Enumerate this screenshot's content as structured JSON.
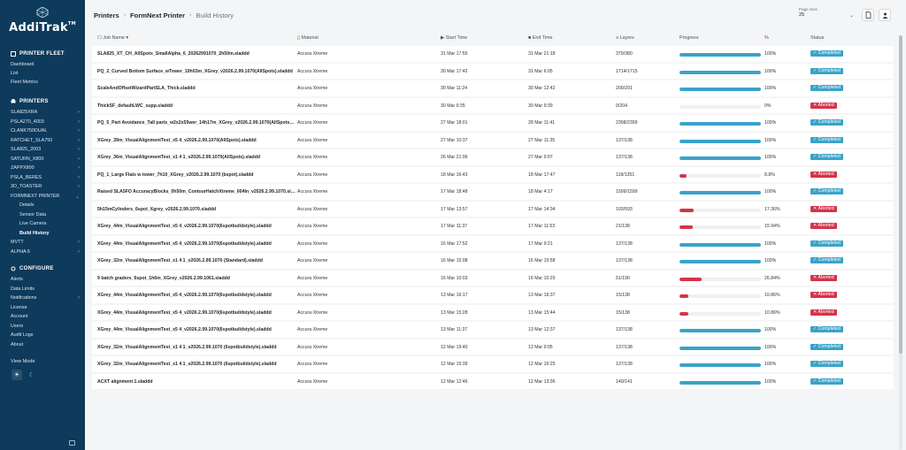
{
  "app": {
    "name": "AddiTrak",
    "trademark": "TM"
  },
  "sidebar": {
    "fleet_title": "PRINTER FLEET",
    "fleet_items": [
      "Dashboard",
      "List",
      "Fleet Metrics"
    ],
    "printers_title": "PRINTERS",
    "printers": [
      {
        "label": "SLA825XRA",
        "expand": true
      },
      {
        "label": "PSLA270_4003",
        "expand": true
      },
      {
        "label": "CLANK750DUAL",
        "expand": true
      },
      {
        "label": "RATCHET_SLA750",
        "expand": true
      },
      {
        "label": "SLA825_2003",
        "expand": true
      },
      {
        "label": "SATURN_X800",
        "expand": true
      },
      {
        "label": "ZAPPX800",
        "expand": true
      },
      {
        "label": "PSLA_BERES",
        "expand": true
      },
      {
        "label": "3D_TOASTER",
        "expand": true
      },
      {
        "label": "FORMNEXT PRINTER",
        "expand": true
      }
    ],
    "printer_sub": [
      "Details",
      "Sensor Data",
      "Live Camera",
      "Build History"
    ],
    "printers_after": [
      {
        "label": "MVTT",
        "expand": true
      },
      {
        "label": "ALPHA 6",
        "expand": true
      }
    ],
    "configure_title": "CONFIGURE",
    "configure_items": [
      {
        "label": "Alerts",
        "expand": false
      },
      {
        "label": "Data Limits",
        "expand": false
      },
      {
        "label": "Notifications",
        "expand": true
      },
      {
        "label": "License",
        "expand": false
      },
      {
        "label": "Account",
        "expand": false
      },
      {
        "label": "Users",
        "expand": false
      },
      {
        "label": "Audit Logs",
        "expand": false
      },
      {
        "label": "About",
        "expand": false
      }
    ],
    "view_mode_label": "View Mode"
  },
  "header": {
    "crumb1": "Printers",
    "crumb2": "FormNext Printer",
    "crumb3": "Build History",
    "page_size_label": "Page Size",
    "page_size_value": "25"
  },
  "table": {
    "columns": {
      "name": "Job Name",
      "material": "Material",
      "start": "Start Time",
      "end": "End Time",
      "layers": "Layers",
      "progress": "Progress",
      "pct": "%",
      "status": "Status"
    },
    "colors": {
      "completed": "#3aa3c9",
      "aborted": "#d6334a"
    },
    "rows": [
      {
        "name": "SLA825_XT_CH_AllSpots_SmallAlpha_6_20262991070_2h50m.sladdd",
        "material": "Accura Xtreme",
        "start": "31 Mar 17:55",
        "end": "31 Mar 21:18",
        "layers": "379/380",
        "pct": "100%",
        "progress": 1.0,
        "status": "Completed"
      },
      {
        "name": "PQ_2_Curved Bottom Surface_wTower_10h03m_XGrey_v2026.2.99.1070(AllSpots).sladdd",
        "material": "Accura Xtreme",
        "start": "30 Mar 17:42",
        "end": "31 Mar 6:05",
        "layers": "1714/1715",
        "pct": "100%",
        "progress": 1.0,
        "status": "Completed"
      },
      {
        "name": "ScaleAndOffsetWizardPartSLA_Thick.sladdd",
        "material": "Accura Xtreme",
        "start": "30 Mar 11:24",
        "end": "30 Mar 12:42",
        "layers": "200/201",
        "pct": "100%",
        "progress": 1.0,
        "status": "Completed"
      },
      {
        "name": "ThickSF_defaultLWC_supp.sladdd",
        "material": "Accura Xtreme",
        "start": "30 Mar 9:35",
        "end": "30 Mar 9:39",
        "layers": "0/204",
        "pct": "0%",
        "progress": 0.0,
        "status": "Aborted"
      },
      {
        "name": "PQ_5_Part Avoidance_Tall parts_w2x2x55wer_14h17m_XGrey_v2026.2.99.1070(AllSpots).sladdd",
        "material": "Accura Xtreme",
        "start": "27 Mar 18:01",
        "end": "28 Mar 11:41",
        "layers": "2398/2399",
        "pct": "100%",
        "progress": 1.0,
        "status": "Completed"
      },
      {
        "name": "XGrey_39m_VisualAlignmentTest_x5 4_v2026.2.99.1070(AllSpots).sladdd",
        "material": "Accura Xtreme",
        "start": "27 Mar 10:37",
        "end": "27 Mar 11:35",
        "layers": "137/138",
        "pct": "100%",
        "progress": 1.0,
        "status": "Completed"
      },
      {
        "name": "XGrey_36m_VisualAlignmentTest_x1 4 1_v2026.2.99.1070(AllSpots).sladdd",
        "material": "Accura Xtreme",
        "start": "26 Mar 21:06",
        "end": "27 Mar 9:07",
        "layers": "137/138",
        "pct": "100%",
        "progress": 1.0,
        "status": "Completed"
      },
      {
        "name": "PQ_1_Large Flats w tower_7h10_XGrey_v2026.2.99.1070 (bspot).sladdd",
        "material": "Accura Xtreme",
        "start": "18 Mar 16:43",
        "end": "18 Mar 17:47",
        "layers": "118/1351",
        "pct": "8.8%",
        "progress": 0.088,
        "status": "Aborted"
      },
      {
        "name": "Raised SLA5FO AccuracyBlocks_0h50m_ContourHatchXtreme_004In_v2026.2.99.1070.sladdd",
        "material": "Accura Xtreme",
        "start": "17 Mar 18:48",
        "end": "18 Mar 4:17",
        "layers": "1599/1599",
        "pct": "100%",
        "progress": 1.0,
        "status": "Completed"
      },
      {
        "name": "5h15mCylinders_6spot_Xgrey_v2026.2.99.1070.sladdd",
        "material": "Accura Xtreme",
        "start": "17 Mar 13:57",
        "end": "17 Mar 14:34",
        "layers": "103/593",
        "pct": "17.36%",
        "progress": 0.1736,
        "status": "Aborted"
      },
      {
        "name": "XGrey_44m_VisualAlignmentTest_x5 4_v2026.2.99.1070(6spotbuildstyle).sladdd",
        "material": "Accura Xtreme",
        "start": "17 Mar 11:37",
        "end": "17 Mar 11:53",
        "layers": "21/138",
        "pct": "15.94%",
        "progress": 0.1594,
        "status": "Aborted"
      },
      {
        "name": "XGrey_44m_VisualAlignmentTest_x5 4_v2026.2.99.1070(6spotbuildstyle).sladdd",
        "material": "Accura Xtreme",
        "start": "16 Mar 17:52",
        "end": "17 Mar 9:21",
        "layers": "137/138",
        "pct": "100%",
        "progress": 1.0,
        "status": "Completed"
      },
      {
        "name": "XGrey_32m_VisualAlignmentTest_x1 4 1_v2026.2.99.1070 (Standard).sladdd",
        "material": "Accura Xtreme",
        "start": "16 Mar 15:08",
        "end": "16 Mar 15:58",
        "layers": "137/138",
        "pct": "100%",
        "progress": 1.0,
        "status": "Completed"
      },
      {
        "name": "9 batch graders_6spot_1h6m_XGrey_v2026.2.99.1061.sladdd",
        "material": "Accura Xtreme",
        "start": "16 Mar 10:03",
        "end": "16 Mar 10:29",
        "layers": "51/190",
        "pct": "26.84%",
        "progress": 0.2684,
        "status": "Aborted"
      },
      {
        "name": "XGrey_44m_VisualAlignmentTest_x5 4_v2026.2.99.1070(6spotbuildstyle).sladdd",
        "material": "Accura Xtreme",
        "start": "13 Mar 16:17",
        "end": "13 Mar 16:37",
        "layers": "15/138",
        "pct": "10.86%",
        "progress": 0.1086,
        "status": "Aborted"
      },
      {
        "name": "XGrey_44m_VisualAlignmentTest_x5 4_v2026.2.99.1070(6spotbuildstyle).sladdd",
        "material": "Accura Xtreme",
        "start": "13 Mar 15:28",
        "end": "13 Mar 15:44",
        "layers": "15/138",
        "pct": "10.86%",
        "progress": 0.1086,
        "status": "Aborted"
      },
      {
        "name": "XGrey_44m_VisualAlignmentTest_x5 4_v2026.2.99.1070(6spotbuildstyle).sladdd",
        "material": "Accura Xtreme",
        "start": "13 Mar 11:37",
        "end": "13 Mar 12:37",
        "layers": "137/138",
        "pct": "100%",
        "progress": 1.0,
        "status": "Completed"
      },
      {
        "name": "XGrey_32m_VisualAlignmentTest_x1 4 1_v2026.2.99.1070 (6spotbuildstyle).sladdd",
        "material": "Accura Xtreme",
        "start": "12 Mar 19:40",
        "end": "13 Mar 9:05",
        "layers": "137/138",
        "pct": "100%",
        "progress": 1.0,
        "status": "Completed"
      },
      {
        "name": "XGrey_32m_VisualAlignmentTest_x1 4 1_v2026.2.99.1070 (6spotbuildstyle).sladdd",
        "material": "Accura Xtreme",
        "start": "12 Mar 15:39",
        "end": "12 Mar 16:25",
        "layers": "137/138",
        "pct": "100%",
        "progress": 1.0,
        "status": "Completed"
      },
      {
        "name": "ACXT alignment 1.sladdd",
        "material": "Accura Xtreme",
        "start": "12 Mar 12:46",
        "end": "12 Mar 13:36",
        "layers": "140/141",
        "pct": "100%",
        "progress": 1.0,
        "status": "Completed"
      }
    ]
  }
}
